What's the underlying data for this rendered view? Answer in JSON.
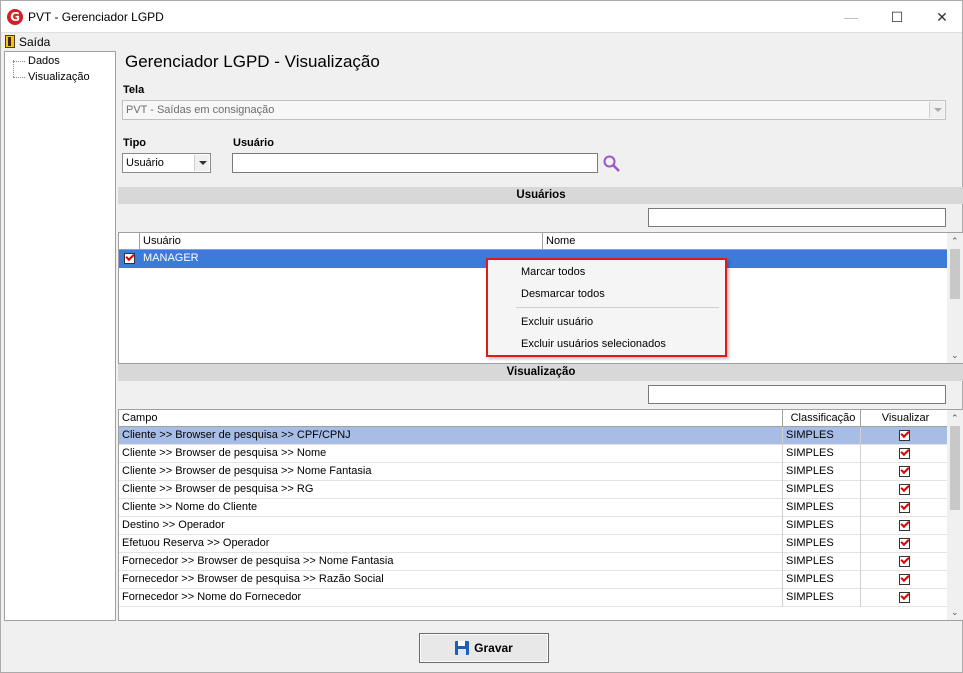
{
  "window": {
    "title": "PVT - Gerenciador LGPD",
    "logo_letter": "G",
    "minimize": "—",
    "maximize": "☐",
    "close": "✕"
  },
  "menu": {
    "exit_label": "Saída"
  },
  "tree": {
    "items": [
      {
        "label": "Dados"
      },
      {
        "label": "Visualização"
      }
    ]
  },
  "page": {
    "title": "Gerenciador LGPD - Visualização"
  },
  "form": {
    "tela_label": "Tela",
    "tela_value": "PVT - Saídas em consignação",
    "tipo_label": "Tipo",
    "tipo_value": "Usuário",
    "usuario_label": "Usuário",
    "usuario_value": ""
  },
  "users_section": {
    "title": "Usuários",
    "search_value": "",
    "columns": [
      "Usuário",
      "Nome"
    ],
    "rows": [
      {
        "checked": true,
        "usuario": "MANAGER",
        "nome": ""
      }
    ]
  },
  "context_menu": {
    "items": [
      "Marcar todos",
      "Desmarcar todos",
      "Excluir usuário",
      "Excluir usuários selecionados"
    ]
  },
  "view_section": {
    "title": "Visualização",
    "search_value": "",
    "columns": [
      "Campo",
      "Classificação",
      "Visualizar"
    ],
    "rows": [
      {
        "campo": "Cliente >> Browser de pesquisa >> CPF/CPNJ",
        "classificacao": "SIMPLES",
        "visualizar": true
      },
      {
        "campo": "Cliente >> Browser de pesquisa >> Nome",
        "classificacao": "SIMPLES",
        "visualizar": true
      },
      {
        "campo": "Cliente >> Browser de pesquisa >> Nome Fantasia",
        "classificacao": "SIMPLES",
        "visualizar": true
      },
      {
        "campo": "Cliente >> Browser de pesquisa >> RG",
        "classificacao": "SIMPLES",
        "visualizar": true
      },
      {
        "campo": "Cliente >> Nome do Cliente",
        "classificacao": "SIMPLES",
        "visualizar": true
      },
      {
        "campo": "Destino >> Operador",
        "classificacao": "SIMPLES",
        "visualizar": true
      },
      {
        "campo": "Efetuou Reserva >> Operador",
        "classificacao": "SIMPLES",
        "visualizar": true
      },
      {
        "campo": "Fornecedor >> Browser de pesquisa >> Nome Fantasia",
        "classificacao": "SIMPLES",
        "visualizar": true
      },
      {
        "campo": "Fornecedor >> Browser de pesquisa >> Razão Social",
        "classificacao": "SIMPLES",
        "visualizar": true
      },
      {
        "campo": "Fornecedor >> Nome do Fornecedor",
        "classificacao": "SIMPLES",
        "visualizar": true
      }
    ]
  },
  "footer": {
    "save_label": "Gravar"
  },
  "colors": {
    "accent_red": "#e01a1a",
    "selection_blue": "#3d7bd9",
    "row_selected": "#a8bde6"
  }
}
